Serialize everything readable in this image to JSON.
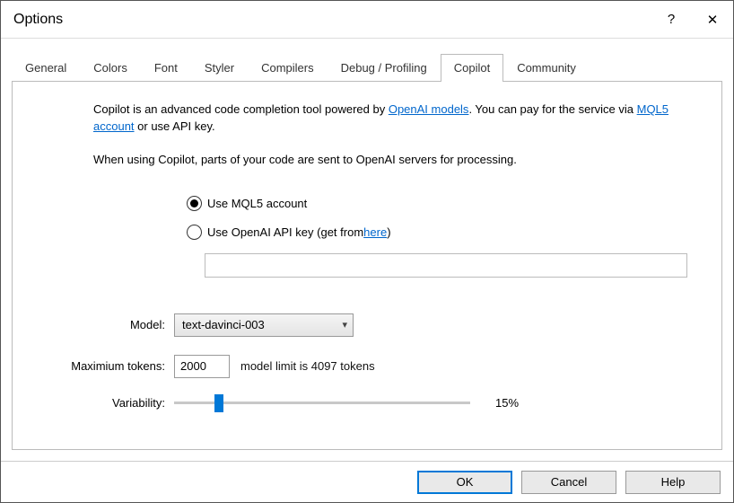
{
  "window": {
    "title": "Options",
    "help_glyph": "?",
    "close_glyph": "✕"
  },
  "tabs": {
    "items": [
      {
        "label": "General"
      },
      {
        "label": "Colors"
      },
      {
        "label": "Font"
      },
      {
        "label": "Styler"
      },
      {
        "label": "Compilers"
      },
      {
        "label": "Debug / Profiling"
      },
      {
        "label": "Copilot"
      },
      {
        "label": "Community"
      }
    ],
    "active": "Copilot"
  },
  "copilot": {
    "desc": {
      "t1": "Copilot is an advanced code completion tool powered by ",
      "link1": "OpenAI models",
      "t2": ". You can pay for the service via ",
      "link2": "MQL5 account",
      "t3": " or use API key.",
      "line2": "When using Copilot, parts of your code are sent to OpenAI servers for processing."
    },
    "auth": {
      "opt1": "Use MQL5 account",
      "opt2": "Use OpenAI API key",
      "opt2_suffix_open": "(get from ",
      "opt2_link": "here",
      "opt2_suffix_close": ")",
      "selected": "mql5",
      "api_key_value": ""
    },
    "model": {
      "label": "Model:",
      "value": "text-davinci-003"
    },
    "max_tokens": {
      "label": "Maximium tokens:",
      "value": "2000",
      "hint": "model limit is 4097 tokens"
    },
    "variability": {
      "label": "Variability:",
      "percent": 15,
      "display": "15%"
    }
  },
  "buttons": {
    "ok": "OK",
    "cancel": "Cancel",
    "help": "Help"
  }
}
